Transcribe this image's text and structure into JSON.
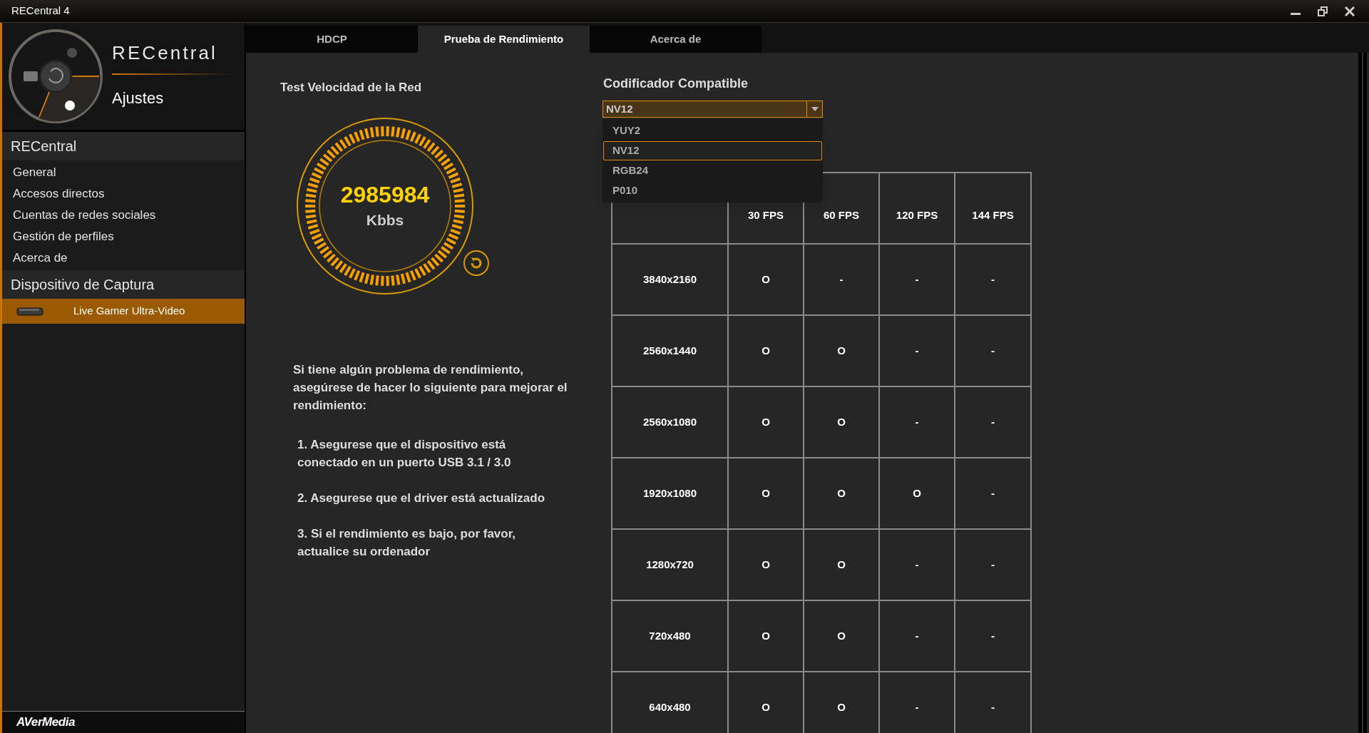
{
  "window": {
    "title": "RECentral 4"
  },
  "sidebar": {
    "logo_text": "RECentral",
    "page_title": "Ajustes",
    "sections": [
      {
        "title": "RECentral",
        "kind": "menu",
        "items": [
          {
            "label": "General",
            "selected": false
          },
          {
            "label": "Accesos directos",
            "selected": false
          },
          {
            "label": "Cuentas de redes sociales",
            "selected": false
          },
          {
            "label": "Gestión de perfiles",
            "selected": false
          },
          {
            "label": "Acerca de",
            "selected": false
          }
        ]
      },
      {
        "title": "Dispositivo de Captura",
        "kind": "device",
        "items": [
          {
            "label": "Live Gamer Ultra-Video",
            "selected": true
          }
        ]
      }
    ],
    "brand": "AVerMedia"
  },
  "tabs": [
    {
      "label": "HDCP",
      "selected": false
    },
    {
      "label": "Prueba de Rendimiento",
      "selected": true
    },
    {
      "label": "Acerca de",
      "selected": false
    }
  ],
  "speed_test": {
    "title": "Test Velocidad de la Red",
    "value": "2985984",
    "unit": "Kbbs"
  },
  "tips": {
    "intro": "Si tiene algún problema de rendimiento, asegúrese de hacer lo siguiente para mejorar el rendimiento:",
    "steps": [
      "1. Asegurese que el dispositivo está conectado en un puerto USB 3.1 / 3.0",
      "2. Asegurese que el driver está actualizado",
      "3. Si el rendimiento es bajo, por favor, actualice su ordenador"
    ]
  },
  "encoder": {
    "title": "Codificador Compatible",
    "value": "NV12",
    "expanded": true,
    "options": [
      {
        "label": "YUY2",
        "selected": false
      },
      {
        "label": "NV12",
        "selected": true
      },
      {
        "label": "RGB24",
        "selected": false
      },
      {
        "label": "P010",
        "selected": false
      }
    ]
  },
  "table": {
    "columns": [
      "30 FPS",
      "60 FPS",
      "120 FPS",
      "144 FPS"
    ],
    "rows": [
      {
        "resolution": "3840x2160",
        "cells": [
          "O",
          "-",
          "-",
          "-"
        ]
      },
      {
        "resolution": "2560x1440",
        "cells": [
          "O",
          "O",
          "-",
          "-"
        ]
      },
      {
        "resolution": "2560x1080",
        "cells": [
          "O",
          "O",
          "-",
          "-"
        ]
      },
      {
        "resolution": "1920x1080",
        "cells": [
          "O",
          "O",
          "O",
          "-"
        ]
      },
      {
        "resolution": "1280x720",
        "cells": [
          "O",
          "O",
          "-",
          "-"
        ]
      },
      {
        "resolution": "720x480",
        "cells": [
          "O",
          "O",
          "-",
          "-"
        ]
      },
      {
        "resolution": "640x480",
        "cells": [
          "O",
          "O",
          "-",
          "-"
        ]
      }
    ]
  }
}
